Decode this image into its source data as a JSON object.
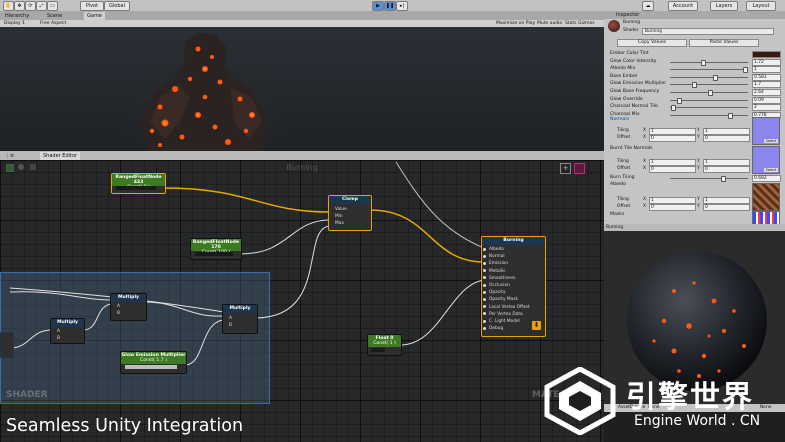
{
  "toolbar": {
    "pivot": "Pivot",
    "global": "Global",
    "account": "Account",
    "layers": "Layers",
    "layout": "Layout"
  },
  "tabs": {
    "hierarchy": "Hierarchy",
    "scene": "Scene",
    "game": "Game",
    "inspector": "Inspector",
    "shader_editor": "Shader Editor"
  },
  "gamebar": {
    "display": "Display 1",
    "aspect": "Free Aspect",
    "maximize": "Maximize on Play",
    "mute": "Mute audio",
    "stats": "Stats",
    "gizmos": "Gizmos"
  },
  "inspector": {
    "material_name": "Burning",
    "shader_label": "Shader",
    "shader_value": "Burning",
    "copy_values": "Copy Values",
    "paste_values": "Paste Values",
    "properties": [
      {
        "label": "Ember Color Tint",
        "value": ""
      },
      {
        "label": "Glow Color Intensity",
        "value": "1.72",
        "fill": 0.42
      },
      {
        "label": "Albedo Mix",
        "value": "1",
        "fill": 0.98
      },
      {
        "label": "Base Ember",
        "value": "0.583",
        "fill": 0.58
      },
      {
        "label": "Glow Emission Multiplier",
        "value": "1.7",
        "fill": 0.3
      },
      {
        "label": "Glow Base Frequency",
        "value": "2.64",
        "fill": 0.52
      },
      {
        "label": "Glow Override",
        "value": "0.09",
        "fill": 0.1
      },
      {
        "label": "Charcoal Normal Tile",
        "value": "2",
        "fill": 0.02
      },
      {
        "label": "Charcoal Mix",
        "value": "0.778",
        "fill": 0.78
      }
    ],
    "normals_label": "Normals",
    "burnt_tile_normals_label": "Burnt Tile Normals",
    "burn_tiling_label": "Burn Tiling",
    "burn_tiling_value": "0.692",
    "burn_tiling_fill": 0.69,
    "albedo_label": "Albedo",
    "masks_label": "Masks",
    "tiling_label": "Tiling",
    "offset_label": "Offset",
    "x_label": "X",
    "y_label": "Y",
    "tiling_x": "1",
    "tiling_y": "1",
    "offset_x": "0",
    "offset_y": "0",
    "select": "Select"
  },
  "editor": {
    "canvas_title": "Burning",
    "nodes": {
      "ranged_top": {
        "title": "RangedFloatNode 433",
        "sub": "Const( 0 )"
      },
      "ranged_mid": {
        "title": "RangedFloatNode 170",
        "sub": "Const( 100 )"
      },
      "clamp": {
        "title": "Clamp",
        "pins": [
          "Value",
          "Min",
          "Max"
        ]
      },
      "burning": {
        "title": "Burning",
        "pins": [
          "Albedo",
          "Normal",
          "Emission",
          "Metallic",
          "Smoothness",
          "Occlusion",
          "Opacity",
          "Opacity Mask",
          "Local Vertex Offset",
          "Per Vertex Data",
          "C. Light Model",
          "Debug"
        ]
      },
      "multiply1": {
        "title": "Multiply",
        "pins": [
          "A",
          "B"
        ]
      },
      "multiply2": {
        "title": "Multiply",
        "pins": [
          "A",
          "B"
        ]
      },
      "multiply3": {
        "title": "Multiply",
        "pins": [
          "A",
          "B"
        ]
      },
      "glow": {
        "title": "Glow Emission Multiplier",
        "sub": "Const( 1.7 )"
      },
      "float": {
        "title": "Float 0",
        "sub": "Const( 1 )"
      }
    },
    "watermark_left": "SHADER",
    "watermark_right": "MATE"
  },
  "preview": {
    "title": "Burning",
    "footer": "AssetBundle",
    "none": "None"
  },
  "branding": {
    "caption": "Seamless Unity Integration",
    "logo_cn": "引擎世界",
    "logo_en": "Engine World . CN"
  },
  "colors": {
    "ember": "#ff5a10",
    "accent": "#f0a000",
    "node_green": "#3d7a24",
    "node_blue": "#1e3550",
    "group_border": "#3c6bb0"
  }
}
